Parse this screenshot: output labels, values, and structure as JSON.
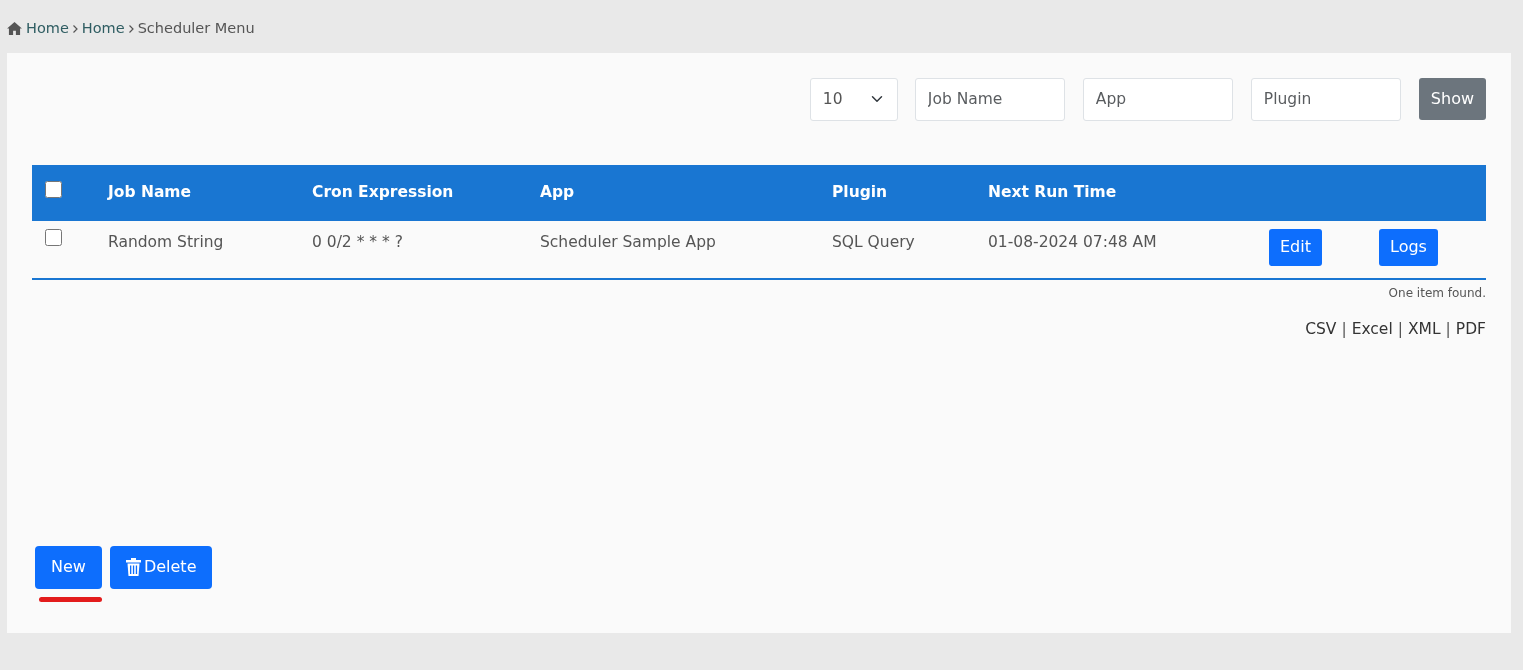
{
  "breadcrumb": [
    {
      "label": "Home",
      "kind": "home"
    },
    {
      "label": "Home",
      "kind": "link"
    },
    {
      "label": "Scheduler Menu",
      "kind": "current"
    }
  ],
  "filters": {
    "page_size": "10",
    "fields": [
      {
        "placeholder": "Job Name"
      },
      {
        "placeholder": "App"
      },
      {
        "placeholder": "Plugin"
      }
    ],
    "button": "Show"
  },
  "table": {
    "select_all": {
      "checked": false
    },
    "columns": [
      "Job Name",
      "Cron Expression",
      "App",
      "Plugin",
      "Next Run Time"
    ],
    "rows": [
      {
        "checked": false,
        "cells": [
          "Random String",
          "0 0/2 * * * ?",
          "Scheduler Sample App",
          "SQL Query",
          "01-08-2024 07:48 AM"
        ],
        "actions": [
          "Edit",
          "Logs"
        ]
      }
    ],
    "footer": "One item found."
  },
  "export": [
    {
      "kind": "link",
      "text": "CSV"
    },
    {
      "kind": "separator",
      "text": "|"
    },
    {
      "kind": "link",
      "text": "Excel"
    },
    {
      "kind": "separator",
      "text": "|"
    },
    {
      "kind": "link",
      "text": "XML"
    },
    {
      "kind": "separator",
      "text": "|"
    },
    {
      "kind": "link",
      "text": "PDF"
    }
  ],
  "actions": [
    {
      "label": "New",
      "kind": "new",
      "underlined": true
    },
    {
      "label": "Delete",
      "kind": "delete",
      "underlined": false
    }
  ]
}
